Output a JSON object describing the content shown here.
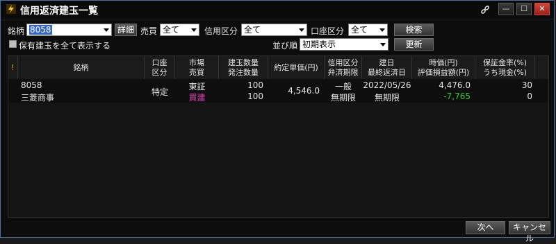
{
  "window": {
    "title": "信用返済建玉一覧",
    "icons": {
      "app": "lightning-icon",
      "link": "link-icon",
      "minimize": "minimize-icon",
      "maximize": "maximize-icon",
      "close": "close-icon"
    },
    "win_minimize": "—",
    "win_maximize": "☐",
    "win_close": "✕"
  },
  "filters": {
    "stock_label": "銘柄",
    "stock_value": "8058",
    "detail_button": "詳細",
    "buysell_label": "売買",
    "buysell_value": "全て",
    "credit_label": "信用区分",
    "credit_value": "全て",
    "account_label": "口座区分",
    "account_value": "全て",
    "search_button": "検索",
    "show_all_label": "保有建玉を全て表示する",
    "sort_label": "並び順",
    "sort_value": "初期表示",
    "refresh_button": "更新"
  },
  "table": {
    "headers": {
      "flag": "!",
      "stock": "銘柄",
      "account_1": "口座",
      "account_2": "区分",
      "market_1": "市場",
      "market_2": "売買",
      "qty_1": "建玉数量",
      "qty_2": "発注数量",
      "price": "約定単価(円)",
      "credit_1": "信用区分",
      "credit_2": "弁済期限",
      "date_1": "建日",
      "date_2": "最終返済日",
      "mkt_1": "時価(円)",
      "mkt_2": "評価損益額(円)",
      "margin_1": "保証金率(%)",
      "margin_2": "うち現金(%)"
    },
    "rows": [
      {
        "code": "8058",
        "name": "三菱商事",
        "account": "特定",
        "market": "東証",
        "side": "買建",
        "position_qty": "100",
        "order_qty": "100",
        "price": "4,546.0",
        "credit": "一般",
        "deadline": "無期限",
        "open_date": "2022/05/26",
        "last_date": "無期限",
        "market_price": "4,476.0",
        "pnl": "-7,765",
        "margin_rate": "30",
        "cash_rate": "0"
      }
    ]
  },
  "footer": {
    "next_button": "次へ",
    "cancel_button": "キャンセル"
  },
  "colors": {
    "side_buy": "#e040b8",
    "pnl_negative": "#33cc33",
    "selection": "#3366cc"
  }
}
